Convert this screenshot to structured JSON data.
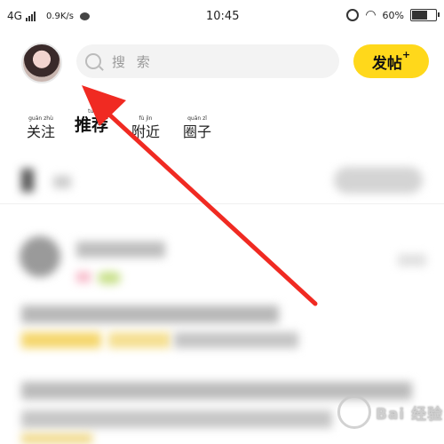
{
  "status_bar": {
    "network": "4G",
    "speed": "0.9K/s",
    "time": "10:45",
    "battery": "60%",
    "battery_level": 0.6
  },
  "header": {
    "search_placeholder": "搜 索",
    "post_button_label": "发帖",
    "post_button_plus": "+"
  },
  "tabs": [
    {
      "label": "关注",
      "pinyin": "guān zhù"
    },
    {
      "label": "推荐",
      "pinyin": "tuī"
    },
    {
      "label": "附近",
      "pinyin": "fù jìn"
    },
    {
      "label": "圈子",
      "pinyin": "quān zǐ"
    }
  ],
  "active_tab": 1,
  "watermark": "Bai 经验",
  "colors": {
    "accent": "#ffd81b",
    "arrow": "#f02a22",
    "search_bg": "#f3f3f3"
  }
}
